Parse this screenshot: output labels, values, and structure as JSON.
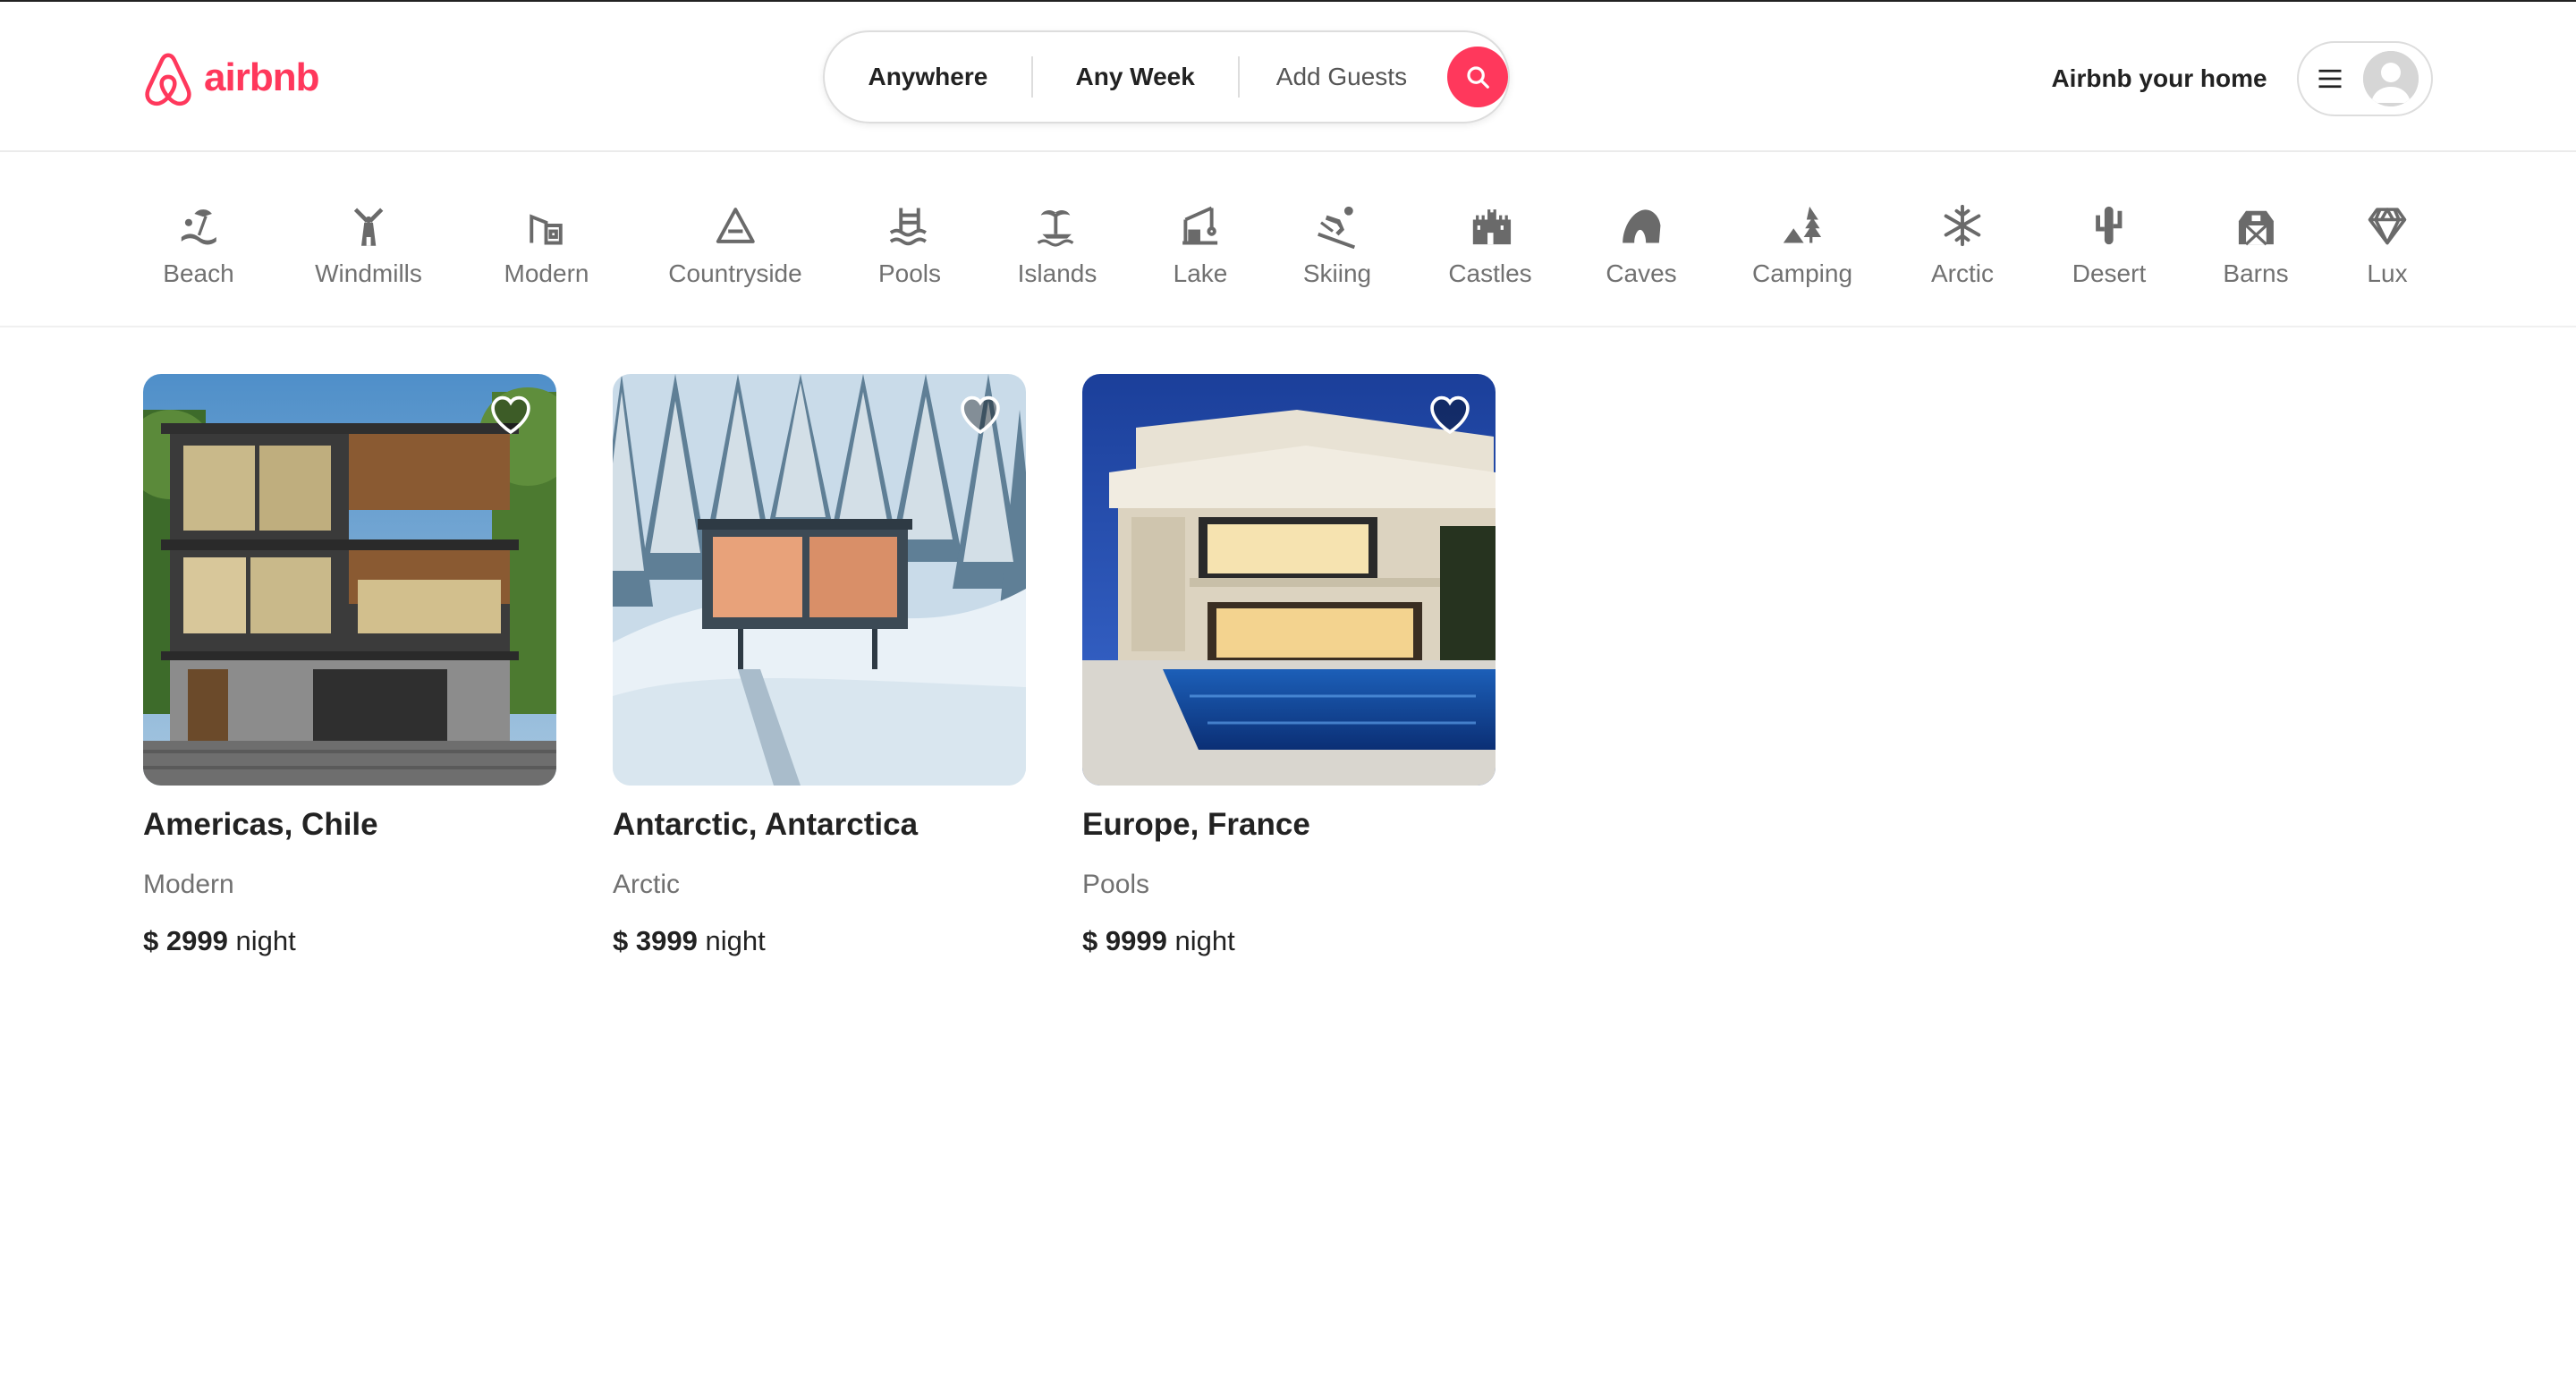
{
  "header": {
    "logo_text": "airbnb",
    "search": {
      "location": "Anywhere",
      "week": "Any Week",
      "guests": "Add Guests"
    },
    "host_link": "Airbnb your home"
  },
  "categories": [
    {
      "label": "Beach",
      "icon": "beach-icon"
    },
    {
      "label": "Windmills",
      "icon": "windmill-icon"
    },
    {
      "label": "Modern",
      "icon": "modern-house-icon"
    },
    {
      "label": "Countryside",
      "icon": "mountain-icon"
    },
    {
      "label": "Pools",
      "icon": "pool-icon"
    },
    {
      "label": "Islands",
      "icon": "island-icon"
    },
    {
      "label": "Lake",
      "icon": "lake-icon"
    },
    {
      "label": "Skiing",
      "icon": "skiing-icon"
    },
    {
      "label": "Castles",
      "icon": "castle-icon"
    },
    {
      "label": "Caves",
      "icon": "cave-icon"
    },
    {
      "label": "Camping",
      "icon": "camping-icon"
    },
    {
      "label": "Arctic",
      "icon": "snowflake-icon"
    },
    {
      "label": "Desert",
      "icon": "cactus-icon"
    },
    {
      "label": "Barns",
      "icon": "barn-icon"
    },
    {
      "label": "Lux",
      "icon": "diamond-icon"
    }
  ],
  "listings": [
    {
      "location": "Americas, Chile",
      "category": "Modern",
      "currency": "$",
      "price": "2999",
      "unit": "night"
    },
    {
      "location": "Antarctic, Antarctica",
      "category": "Arctic",
      "currency": "$",
      "price": "3999",
      "unit": "night"
    },
    {
      "location": "Europe, France",
      "category": "Pools",
      "currency": "$",
      "price": "9999",
      "unit": "night"
    }
  ],
  "colors": {
    "brand": "#ff385c",
    "text": "#222222",
    "muted": "#717171",
    "border": "#dddddd"
  }
}
